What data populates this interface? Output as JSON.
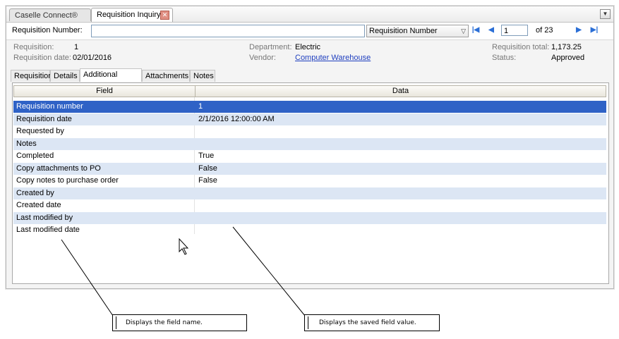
{
  "doc_tabs": [
    {
      "label": "Caselle Connect®"
    },
    {
      "label": "Requisition Inquiry"
    }
  ],
  "toolbar": {
    "number_label": "Requisition Number:",
    "number_value": "",
    "search_by": "Requisition Number",
    "page_value": "1",
    "page_of": "of 23"
  },
  "header_info": {
    "requisition_label": "Requisition:",
    "requisition_value": "1",
    "date_label": "Requisition date:",
    "date_value": "02/01/2016",
    "department_label": "Department:",
    "department_value": "Electric",
    "vendor_label": "Vendor:",
    "vendor_value": "Computer Warehouse",
    "total_label": "Requisition total:",
    "total_value": "1,173.25",
    "status_label": "Status:",
    "status_value": "Approved"
  },
  "sub_tabs": [
    {
      "label": "Requisition"
    },
    {
      "label": "Details"
    },
    {
      "label": "Additional Fields"
    },
    {
      "label": "Attachments"
    },
    {
      "label": "Notes"
    }
  ],
  "grid": {
    "columns": [
      "Field",
      "Data"
    ],
    "rows": [
      {
        "field": "Requisition number",
        "data": "1"
      },
      {
        "field": "Requisition date",
        "data": "2/1/2016 12:00:00 AM"
      },
      {
        "field": "Requested by",
        "data": ""
      },
      {
        "field": "Notes",
        "data": ""
      },
      {
        "field": "Completed",
        "data": "True"
      },
      {
        "field": "Copy attachments to PO",
        "data": "False"
      },
      {
        "field": "Copy notes to purchase order",
        "data": "False"
      },
      {
        "field": "Created by",
        "data": ""
      },
      {
        "field": "Created date",
        "data": ""
      },
      {
        "field": "Last modified by",
        "data": ""
      },
      {
        "field": "Last modified date",
        "data": ""
      }
    ]
  },
  "callouts": [
    {
      "text": "Displays the field name."
    },
    {
      "text": "Displays the saved field value."
    }
  ],
  "colors": {
    "selection": "#2f62c6",
    "alt_row": "#dce6f4",
    "link": "#1f3fbf"
  }
}
